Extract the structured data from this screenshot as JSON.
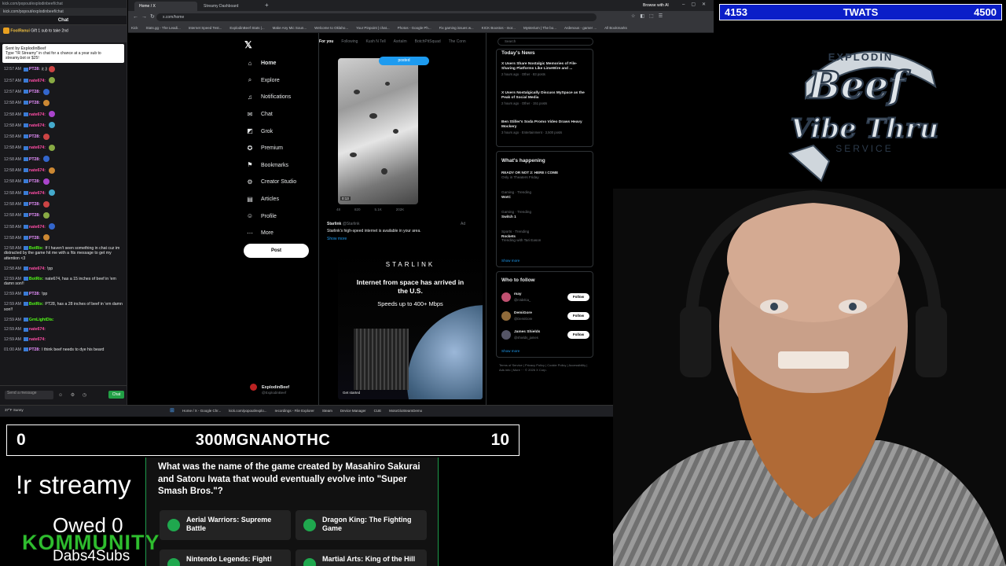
{
  "colors": {
    "overlay_blue": "#0a1ec8",
    "accent_green": "#1fa84e",
    "x_blue": "#1d9bf0",
    "chat_bg": "#18181b"
  },
  "chat": {
    "window_url": "kick.com/popout/explodinbeef/chat",
    "header": "Chat",
    "hype_user": "FoolRanui",
    "hype_text": "Gift 1 sub to take 2nd",
    "pinned_user": "Sent by ExplodinBeef",
    "pinned_text": "Type \"!R Streamy\" in chat for a chance at a year sub to streamy.bot or $25!",
    "messages": [
      {
        "t": "12:57 AM",
        "u": "PT28:",
        "m": "it 3",
        "c": "#e891ff"
      },
      {
        "t": "12:57 AM",
        "u": "nate674:",
        "m": "",
        "c": "#ff4da6"
      },
      {
        "t": "12:57 AM",
        "u": "PT28:",
        "m": "",
        "c": "#e891ff"
      },
      {
        "t": "12:58 AM",
        "u": "PT28:",
        "m": "",
        "c": "#e891ff"
      },
      {
        "t": "12:58 AM",
        "u": "nate674:",
        "m": "",
        "c": "#ff4da6"
      },
      {
        "t": "12:58 AM",
        "u": "nate674:",
        "m": "",
        "c": "#ff4da6"
      },
      {
        "t": "12:58 AM",
        "u": "PT28:",
        "m": "",
        "c": "#e891ff"
      },
      {
        "t": "12:58 AM",
        "u": "nate674:",
        "m": "",
        "c": "#ff4da6"
      },
      {
        "t": "12:58 AM",
        "u": "PT28:",
        "m": "",
        "c": "#e891ff"
      },
      {
        "t": "12:58 AM",
        "u": "nate674:",
        "m": "",
        "c": "#ff4da6"
      },
      {
        "t": "12:58 AM",
        "u": "PT28:",
        "m": "",
        "c": "#e891ff"
      },
      {
        "t": "12:58 AM",
        "u": "nate674:",
        "m": "",
        "c": "#ff4da6"
      },
      {
        "t": "12:58 AM",
        "u": "PT28:",
        "m": "",
        "c": "#e891ff"
      },
      {
        "t": "12:58 AM",
        "u": "PT28:",
        "m": "",
        "c": "#e891ff"
      },
      {
        "t": "12:58 AM",
        "u": "nate674:",
        "m": "",
        "c": "#ff4da6"
      },
      {
        "t": "12:58 AM",
        "u": "PT28:",
        "m": "",
        "c": "#e891ff"
      }
    ],
    "long_messages": [
      {
        "t": "12:58 AM",
        "u": "BotRix:",
        "m": "If I haven't seen something in chat cuz im distracted by the game hit me with a !tts message to get my attention <3",
        "c": "#53fc18"
      },
      {
        "t": "12:58 AM",
        "u": "nate674:",
        "m": "!pp",
        "c": "#ff4da6"
      },
      {
        "t": "12:59 AM",
        "u": "BotRix:",
        "m": "nate674, has a 15 inches of beef in 'em damn son!!",
        "c": "#53fc18"
      },
      {
        "t": "12:59 AM",
        "u": "PT28:",
        "m": "!pp",
        "c": "#e891ff"
      },
      {
        "t": "12:59 AM",
        "u": "BotRix:",
        "m": "PT28, has a 28 inches of beef in 'em damn son!!",
        "c": "#53fc18"
      },
      {
        "t": "12:59 AM",
        "u": "GrnLightDis:",
        "m": "",
        "c": "#53fc18"
      },
      {
        "t": "12:59 AM",
        "u": "nate674:",
        "m": "",
        "c": "#ff4da6"
      },
      {
        "t": "12:59 AM",
        "u": "nate674:",
        "m": "",
        "c": "#ff4da6"
      },
      {
        "t": "01:00 AM",
        "u": "PT28:",
        "m": "I think beef needs to dye his beard",
        "c": "#e891ff"
      }
    ],
    "send_placeholder": "Send a message",
    "chat_button": "Chat"
  },
  "browser": {
    "tabs": [
      "Home / X",
      "Streamy Dashboard"
    ],
    "url": "x.com/home",
    "right_label": "Browse with AI",
    "bookmarks": [
      "Kick",
      "Stats.gg - The Leadi...",
      "Internet Speed Test...",
      "ExplodinBeef Stats |...",
      "Make Any Mic Soun...",
      "Welcome to Oklaho...",
      "Your Pinpoint | chat...",
      "Photos - Google Ph...",
      "Fix gaming issues w...",
      "KICK Boostos - mor...",
      "Mysterium | The bo...",
      "Ardenous - gamer ...",
      "All Bookmarks"
    ]
  },
  "x": {
    "nav": [
      {
        "label": "Home",
        "icon": "home-icon",
        "bold": true
      },
      {
        "label": "Explore",
        "icon": "search-icon"
      },
      {
        "label": "Notifications",
        "icon": "bell-icon"
      },
      {
        "label": "Chat",
        "icon": "chat-icon"
      },
      {
        "label": "Grok",
        "icon": "grok-icon"
      },
      {
        "label": "Premium",
        "icon": "premium-icon"
      },
      {
        "label": "Bookmarks",
        "icon": "bookmark-icon"
      },
      {
        "label": "Creator Studio",
        "icon": "creator-icon"
      },
      {
        "label": "Articles",
        "icon": "articles-icon"
      },
      {
        "label": "Profile",
        "icon": "profile-icon"
      },
      {
        "label": "More",
        "icon": "more-icon"
      }
    ],
    "post_button": "Post",
    "account_name": "ExplodinBeef",
    "account_handle": "@ExplodinBeef",
    "timeline_tabs": [
      "For you",
      "Following",
      "Kush N Tell",
      "Asrtalm",
      "BotchPitSquad",
      "The Conn"
    ],
    "posted_pill": "posted",
    "video_time": "0:13",
    "post_stats": [
      "48",
      "820",
      "5.1K",
      "202K"
    ],
    "ad_name": "Starlink",
    "ad_handle": "@Starlink",
    "ad_label": "Ad",
    "ad_text": "Starlink's high-speed internet is available in your area.",
    "show_more": "Show more",
    "ad_brand": "STARLINK",
    "ad_headline": "Internet from space has arrived in the U.S.",
    "ad_sub": "Speeds up to 400+ Mbps",
    "ad_cta": "Get started",
    "search_placeholder": "Search",
    "news_title": "Today's News",
    "news": [
      {
        "title": "X Users Share Nostalgic Memories of File-Sharing Platforms Like LimeWire and ...",
        "meta": "2 hours ago · Other · 83 posts"
      },
      {
        "title": "X Users Nostalgically Discuss MySpace as the Peak of Social Media",
        "meta": "2 hours ago · Other · 151 posts"
      },
      {
        "title": "Ben Stiller's Soda Promo Video Draws Heavy Mockery",
        "meta": "3 hours ago · Entertainment · 3,500 posts"
      }
    ],
    "happening_title": "What's happening",
    "trends": [
      {
        "top": "",
        "title": "READY OR NOT 2: HERE I COME",
        "sub": "Only in Theaters Friday"
      },
      {
        "top": "Gaming · Trending",
        "title": "WotC",
        "sub": ""
      },
      {
        "top": "Gaming · Trending",
        "title": "Switch 1",
        "sub": ""
      },
      {
        "top": "Sports · Trending",
        "title": "Rockets",
        "sub": "Trending with Tari Eason"
      }
    ],
    "show_more_link": "Show more",
    "wtf_title": "Who to follow",
    "follows": [
      {
        "name": "may",
        "handle": "@rctdelca_",
        "av": "#c05070"
      },
      {
        "name": "DemiGore",
        "handle": "@DemiGore",
        "av": "#8f6a3a"
      },
      {
        "name": "James Shields",
        "handle": "@shields_james",
        "av": "#556"
      }
    ],
    "follow_label": "Follow",
    "footer": "Terms of Service | Privacy Policy | Cookie Policy | Accessibility | Ads info | More ··· © 2026 X Corp."
  },
  "taskbar": {
    "temp": "37°F",
    "cond": "Sunny",
    "items": [
      "Home / X - Google Chr...",
      "kick.com/popout/explo...",
      "recordings - File Explorer",
      "Steam",
      "Device Manager",
      "CUE",
      "MotoGloSteamDemo"
    ]
  },
  "overlay": {
    "score_left": "4153",
    "score_center": "TWATS",
    "score_right": "4500",
    "logo_top": "EXPLODIN",
    "logo_beef": "Beef",
    "logo_vibe": "Vibe Thru",
    "logo_service": "SERVICE",
    "quiz_left": "0",
    "quiz_center": "300MGNANOTHC",
    "quiz_right": "10",
    "question": "What was the name of the game created by Masahiro Sakurai and Satoru Iwata that would eventually evolve into \"Super Smash Bros.\"?",
    "answers": [
      "Aerial Warriors: Supreme Battle",
      "Dragon King: The Fighting Game",
      "Nintendo Legends: Fight!",
      "Martial Arts: King of the Hill"
    ],
    "streamy": "!r streamy",
    "owed": "Owed 0",
    "kommunity": "KOMMUNITY",
    "dabs": "Dabs4Subs"
  }
}
